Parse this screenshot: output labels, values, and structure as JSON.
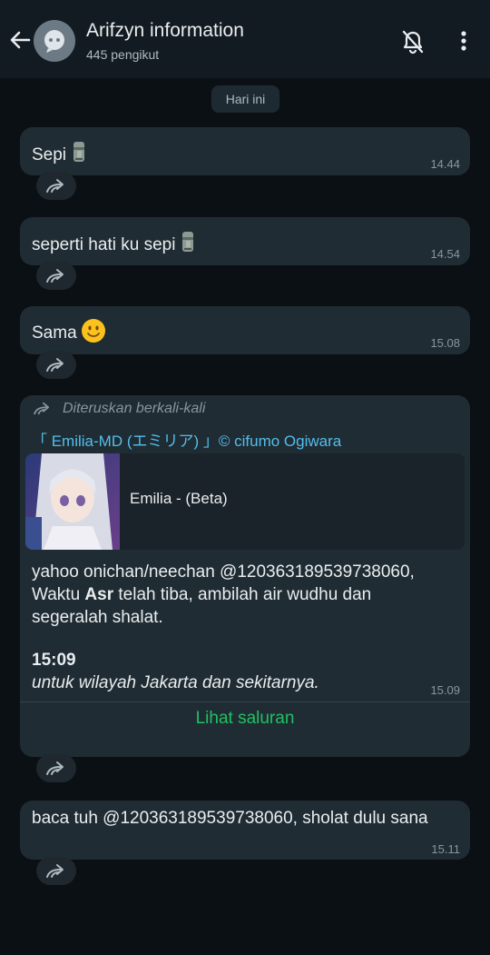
{
  "header": {
    "title": "Arifzyn information",
    "subtitle": "445 pengikut"
  },
  "chat": {
    "date_chip": "Hari ini",
    "messages": [
      {
        "text": "Sepi",
        "emoji": "moai",
        "time": "14.44"
      },
      {
        "text": "seperti hati ku sepi",
        "emoji": "moai",
        "time": "14.54"
      },
      {
        "text": "Sama",
        "emoji": "slightly-smiling-face",
        "time": "15.08"
      },
      {
        "forwarded_label": "Diteruskan berkali-kali",
        "channel_name": "「 Emilia-MD (エミリア) 」© cifumo Ogiwara",
        "card_title": "Emilia - (Beta)",
        "line1": "yahoo onichan/neechan @120363189539738060,",
        "line2_pre": "Waktu ",
        "line2_bold": "Asr",
        "line2_post": " telah tiba, ambilah air wudhu dan",
        "line3": "segeralah shalat.",
        "time_bold": "15:09",
        "region": "untuk wilayah Jakarta dan sekitarnya.",
        "time": "15.09",
        "view_channel": "Lihat saluran"
      },
      {
        "text": "baca tuh @120363189539738060, sholat dulu sana",
        "time": "15.11"
      }
    ]
  },
  "colors": {
    "header_bg": "#121b22",
    "bubble_bg": "#202c33",
    "link_green": "#21c063",
    "channel_blue": "#53bdeb"
  }
}
